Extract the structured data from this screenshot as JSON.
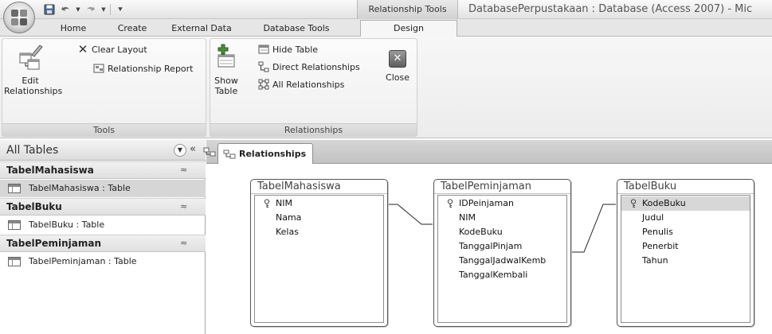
{
  "titlebar": {
    "context_tab": "Relationship Tools",
    "window_title": "DatabasePerpustakaan : Database (Access 2007) - Mic",
    "qat": {
      "save_icon": "save-icon",
      "undo_icon": "undo-icon",
      "redo_icon": "redo-icon",
      "customize_icon": "chevron-down-icon"
    }
  },
  "tabs": [
    "Home",
    "Create",
    "External Data",
    "Database Tools",
    "Design"
  ],
  "ribbon": {
    "tools": {
      "edit_relationships": "Edit Relationships",
      "clear_layout": "Clear Layout",
      "relationship_report": "Relationship Report",
      "label": "Tools"
    },
    "relationships": {
      "show_table_1": "Show",
      "show_table_2": "Table",
      "hide_table": "Hide Table",
      "direct_relationships": "Direct Relationships",
      "all_relationships": "All Relationships",
      "close": "Close",
      "label": "Relationships"
    }
  },
  "navpane": {
    "title": "All Tables",
    "groups": [
      {
        "name": "TabelMahasiswa",
        "item": "TabelMahasiswa : Table"
      },
      {
        "name": "TabelBuku",
        "item": "TabelBuku : Table"
      },
      {
        "name": "TabelPeminjaman",
        "item": "TabelPeminjaman : Table"
      }
    ]
  },
  "document": {
    "tab_label": "Relationships",
    "tables": [
      {
        "name": "TabelMahasiswa",
        "fields": [
          "NIM",
          "Nama",
          "Kelas"
        ],
        "key": "NIM"
      },
      {
        "name": "TabelPeminjaman",
        "fields": [
          "IDPeinjaman",
          "NIM",
          "KodeBuku",
          "TanggalPinjam",
          "TanggalJadwalKemb",
          "TanggalKembali"
        ],
        "key": "IDPeinjaman"
      },
      {
        "name": "TabelBuku",
        "fields": [
          "KodeBuku",
          "Judul",
          "Penulis",
          "Penerbit",
          "Tahun"
        ],
        "key": "KodeBuku",
        "selected": "KodeBuku"
      }
    ]
  }
}
